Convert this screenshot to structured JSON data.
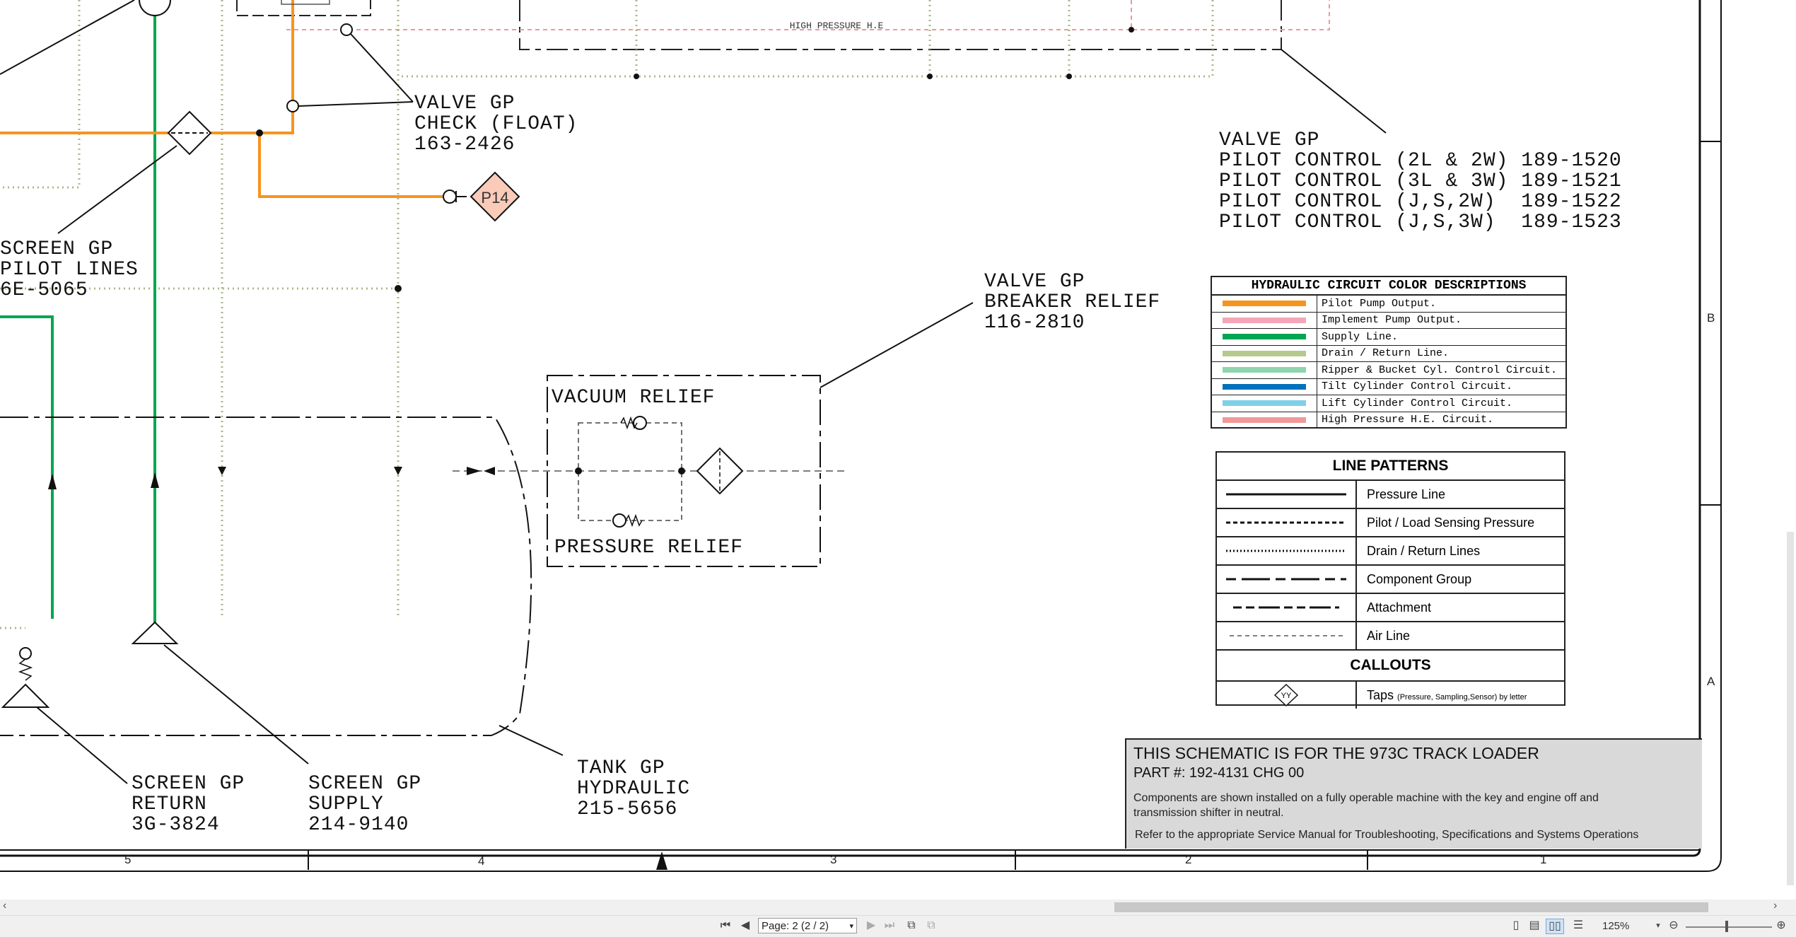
{
  "diagram": {
    "top_label": "HIGH PRESSURE H.E",
    "labels": {
      "valve_check": [
        "VALVE GP",
        "CHECK (FLOAT)",
        "163-2426"
      ],
      "valve_pilot": [
        "VALVE GP",
        "PILOT CONTROL (2L & 2W) 189-1520",
        "PILOT CONTROL (3L & 3W) 189-1521",
        "PILOT CONTROL (J,S,2W)  189-1522",
        "PILOT CONTROL (J,S,3W)  189-1523"
      ],
      "screen_pilot": [
        "SCREEN GP",
        "PILOT LINES",
        "6E-5065"
      ],
      "valve_breaker": [
        "VALVE GP",
        "BREAKER RELIEF",
        "116-2810"
      ],
      "vacuum_relief": "VACUUM RELIEF",
      "pressure_relief": "PRESSURE RELIEF",
      "screen_return": [
        "SCREEN GP",
        "RETURN",
        "3G-3824"
      ],
      "screen_supply": [
        "SCREEN GP",
        "SUPPLY",
        "214-9140"
      ],
      "tank": [
        "TANK GP",
        "HYDRAULIC",
        "215-5656"
      ],
      "tap_p14": "P14"
    }
  },
  "color_legend": {
    "title": "HYDRAULIC CIRCUIT COLOR DESCRIPTIONS",
    "items": [
      {
        "color": "#f7941d",
        "label": "Pilot Pump Output."
      },
      {
        "color": "#f4a6b8",
        "label": "Implement Pump Output."
      },
      {
        "color": "#00a651",
        "label": "Supply Line."
      },
      {
        "color": "#b5c98e",
        "label": "Drain / Return Line."
      },
      {
        "color": "#8fd4b0",
        "label": "Ripper & Bucket Cyl. Control Circuit."
      },
      {
        "color": "#0072bc",
        "label": "Tilt Cylinder Control Circuit."
      },
      {
        "color": "#7fcfe8",
        "label": "Lift Cylinder Control Circuit."
      },
      {
        "color": "#ef9a9a",
        "label": "High Pressure H.E. Circuit."
      }
    ]
  },
  "pattern_legend": {
    "title": "LINE PATTERNS",
    "items": [
      {
        "pattern": "solid",
        "label": "Pressure Line"
      },
      {
        "pattern": "dashed",
        "label": "Pilot / Load Sensing Pressure"
      },
      {
        "pattern": "dotted",
        "label": "Drain / Return Lines"
      },
      {
        "pattern": "dash-long",
        "label": "Component Group"
      },
      {
        "pattern": "dash-dot",
        "label": "Attachment"
      },
      {
        "pattern": "fine-dash",
        "label": "Air Line"
      }
    ],
    "callouts_title": "CALLOUTS",
    "callout_symbol": "YY",
    "callout_label": "Taps",
    "callout_note": "(Pressure, Sampling,Sensor) by letter"
  },
  "title_block": {
    "line1": "THIS SCHEMATIC IS FOR THE 973C TRACK LOADER",
    "line2": "PART #: 192-4131 CHG 00",
    "line3": "Components are shown installed on a fully operable machine with the key and engine off and transmission shifter in neutral.",
    "line4": "Refer to the appropriate Service Manual for Troubleshooting, Specifications and Systems Operations"
  },
  "zones": {
    "bottom": [
      "5",
      "4",
      "3",
      "2",
      "1"
    ],
    "right": [
      "B",
      "A"
    ]
  },
  "viewer": {
    "page_field": "Page: 2 (2 / 2)",
    "zoom": "125%",
    "icons": [
      "first-page-icon",
      "prev-page-icon",
      "next-page-icon",
      "last-page-icon"
    ]
  }
}
